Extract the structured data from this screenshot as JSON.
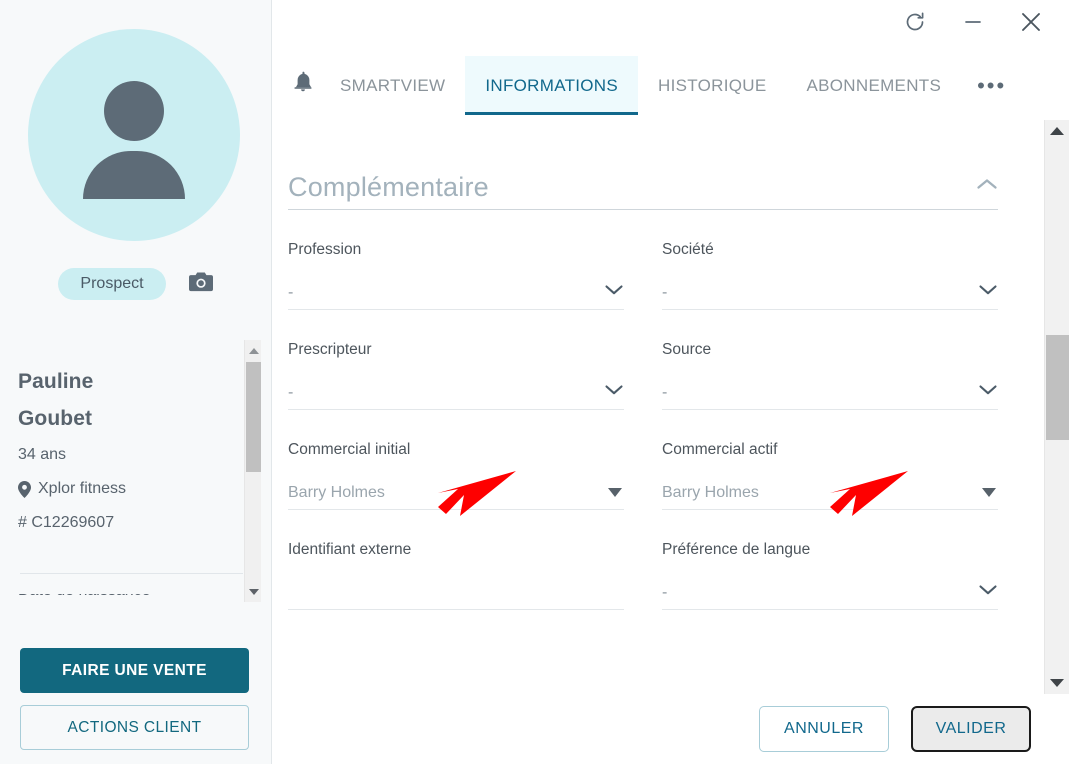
{
  "window": {
    "refresh_icon": "refresh-icon",
    "minimize_icon": "minimize-icon",
    "close_icon": "close-icon"
  },
  "sidebar": {
    "avatar_icon": "person-avatar-icon",
    "badge": "Prospect",
    "camera_icon": "camera-icon",
    "first_name": "Pauline",
    "last_name": "Goubet",
    "age": "34 ans",
    "location_icon": "map-pin-icon",
    "location": "Xplor fitness",
    "reference": "# C12269607",
    "clipped_line": "Date de naissance",
    "sale_button": "FAIRE UNE VENTE",
    "actions_button": "ACTIONS CLIENT",
    "colors": {
      "primary": "#12687f",
      "badge_bg": "#cbeef2",
      "panel_bg": "#f7f9fa"
    }
  },
  "tabs": {
    "bell_icon": "bell-icon",
    "items": [
      {
        "label": "SMARTVIEW",
        "active": false
      },
      {
        "label": "INFORMATIONS",
        "active": true
      },
      {
        "label": "HISTORIQUE",
        "active": false
      },
      {
        "label": "ABONNEMENTS",
        "active": false
      }
    ],
    "overflow": "•••",
    "active_color": "#11688c",
    "active_bg": "#eefafd"
  },
  "form": {
    "section_title": "Complémentaire",
    "collapse_icon": "chevron-up-icon",
    "fields": [
      {
        "label": "Profession",
        "value": "-",
        "control": "select",
        "arrow": "chevron-down-icon"
      },
      {
        "label": "Société",
        "value": "-",
        "control": "select",
        "arrow": "chevron-down-icon"
      },
      {
        "label": "Prescripteur",
        "value": "-",
        "control": "select",
        "arrow": "chevron-down-icon"
      },
      {
        "label": "Source",
        "value": "-",
        "control": "select",
        "arrow": "chevron-down-icon"
      },
      {
        "label": "Commercial initial",
        "value": "Barry Holmes",
        "control": "dropdown",
        "arrow": "triangle-down-icon"
      },
      {
        "label": "Commercial actif",
        "value": "Barry Holmes",
        "control": "dropdown",
        "arrow": "triangle-down-icon"
      },
      {
        "label": "Identifiant externe",
        "value": "",
        "control": "text",
        "arrow": ""
      },
      {
        "label": "Préférence de langue",
        "value": "-",
        "control": "select",
        "arrow": "chevron-down-icon"
      }
    ]
  },
  "annotations": {
    "color": "#fe0000",
    "arrows": [
      {
        "target": "Commercial initial"
      },
      {
        "target": "Commercial actif"
      }
    ]
  },
  "footer": {
    "cancel": "ANNULER",
    "validate": "VALIDER"
  },
  "scrollbars": {
    "sidebar": "sidebar-scrollbar",
    "main": "main-scrollbar"
  }
}
